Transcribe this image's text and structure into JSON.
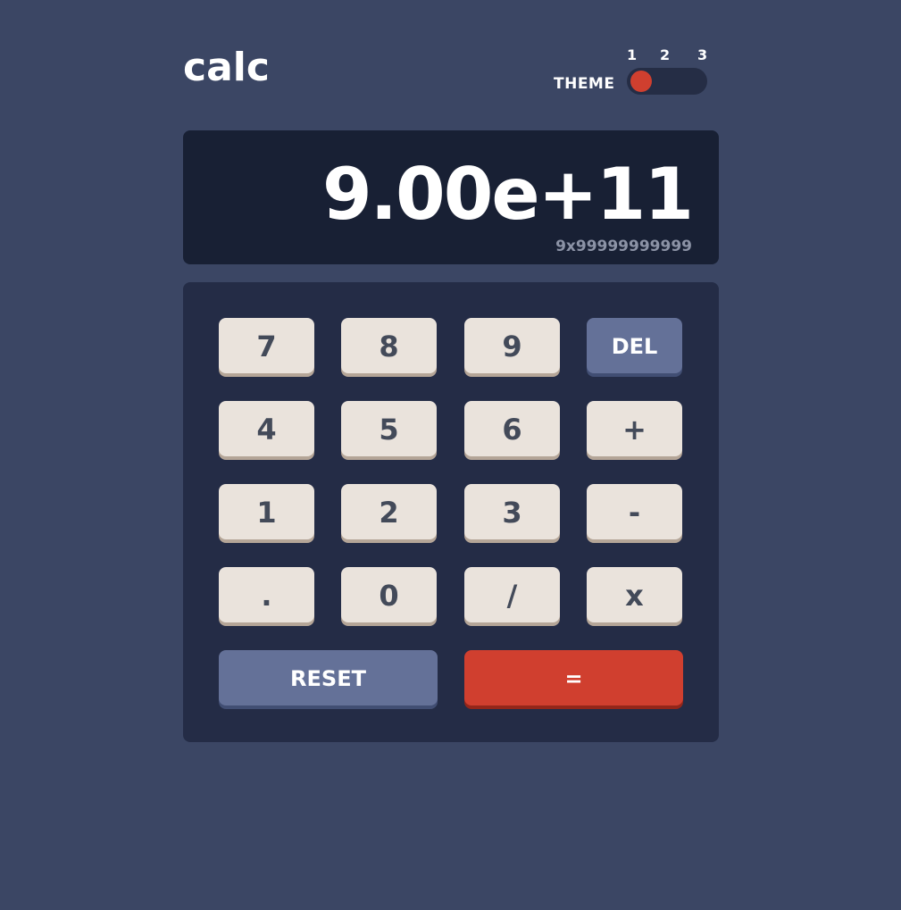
{
  "app": {
    "title": "calc"
  },
  "theme": {
    "label": "THEME",
    "options": [
      "1",
      "2",
      "3"
    ],
    "selected": "1"
  },
  "display": {
    "value": "9.00e+11",
    "expression": "9x99999999999"
  },
  "keys": {
    "k7": "7",
    "k8": "8",
    "k9": "9",
    "del": "DEL",
    "k4": "4",
    "k5": "5",
    "k6": "6",
    "plus": "+",
    "k1": "1",
    "k2": "2",
    "k3": "3",
    "minus": "-",
    "dot": ".",
    "k0": "0",
    "divide": "/",
    "multiply": "x",
    "reset": "RESET",
    "equals": "="
  },
  "colors": {
    "background": "#3b4664",
    "screen": "#182034",
    "keypad": "#242c46",
    "key": "#eae3dc",
    "key_function": "#647198",
    "accent": "#d03f2f"
  }
}
